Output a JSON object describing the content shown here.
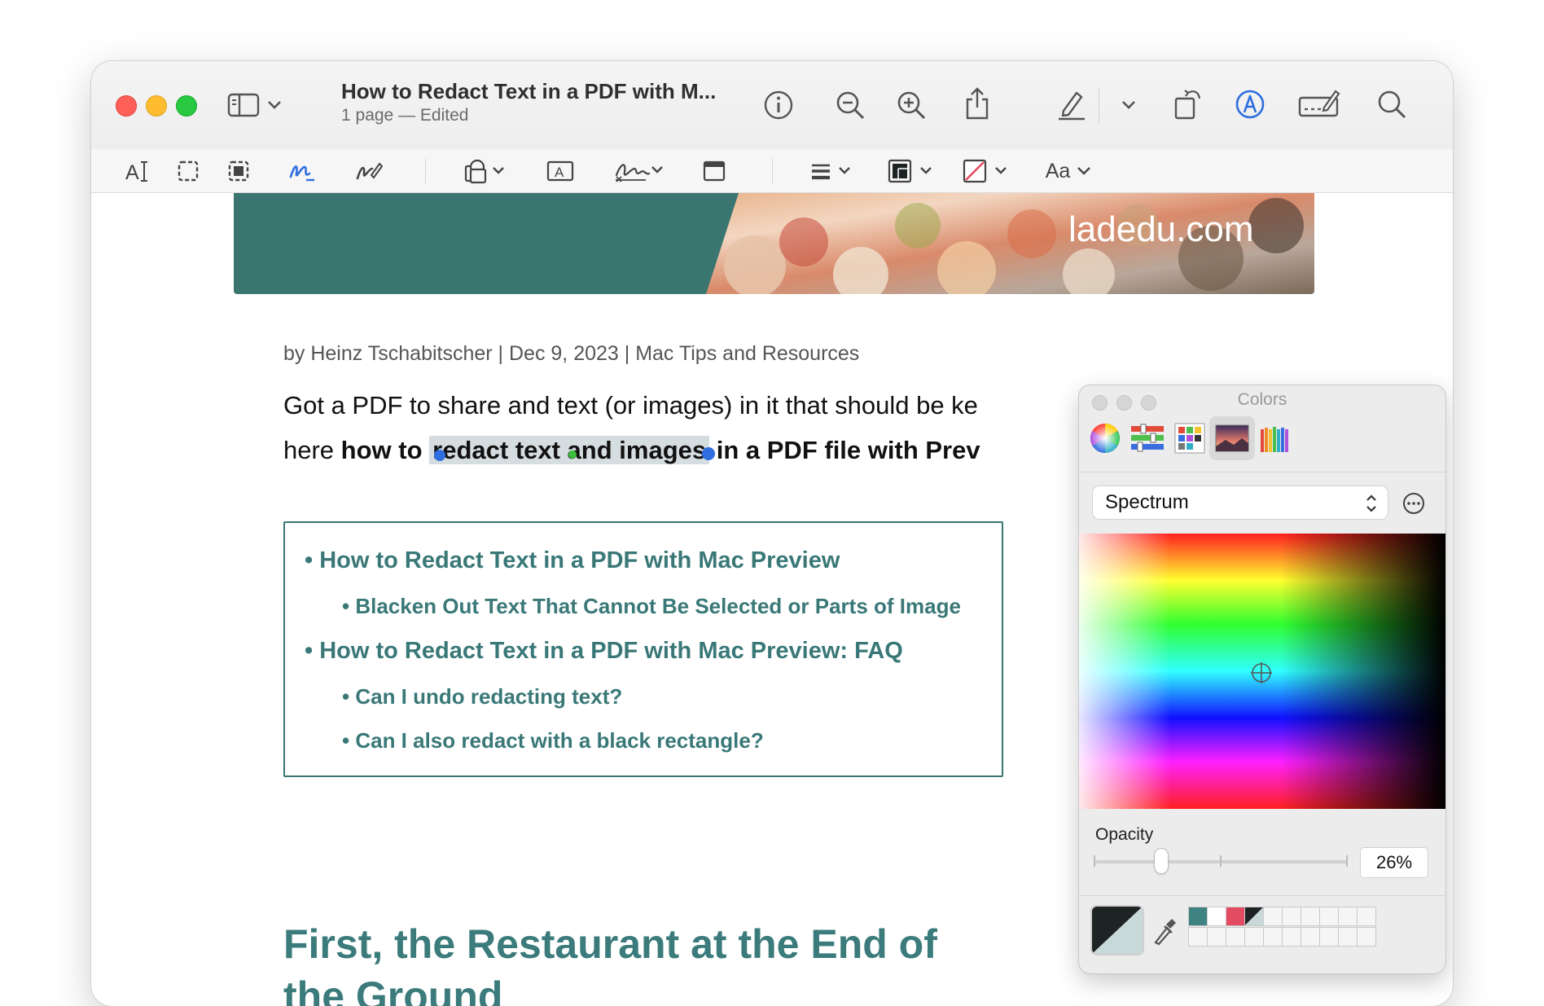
{
  "window": {
    "title": "How to Redact Text in a PDF with M...",
    "subtitle": "1 page — Edited"
  },
  "toolbar": {
    "icons": [
      "sidebar-icon",
      "chevron-down-icon",
      "info-icon",
      "zoom-out-icon",
      "zoom-in-icon",
      "share-icon",
      "highlight-pen-icon",
      "chevron-down-icon",
      "rotate-icon",
      "markup-icon",
      "form-filling-icon",
      "search-icon"
    ]
  },
  "markup_toolbar": {
    "text_style_label": "Aa",
    "icons": [
      "text-selection-icon",
      "rectangular-selection-icon",
      "redact-icon",
      "sketch-icon",
      "draw-icon",
      "shapes-icon",
      "text-box-icon",
      "sign-icon",
      "note-icon",
      "shape-style-icon",
      "border-color-icon",
      "fill-color-icon",
      "text-style-icon"
    ]
  },
  "document": {
    "banner_text": "ladedu.com",
    "byline": "by Heinz Tschabitscher | Dec 9, 2023 | Mac Tips and Resources",
    "intro_line1": "Got a PDF to share and text (or images) in it that should be ke",
    "intro_line2_prefix": "here ",
    "intro_line2_bold": "how to ",
    "intro_line2_selected": "redact text and images",
    "intro_line2_suffix": " in a PDF file with Prev",
    "toc": [
      {
        "text": "How to Redact Text in a PDF with Mac Preview",
        "level": 1
      },
      {
        "text": "Blacken Out Text That Cannot Be Selected or Parts of Image",
        "level": 2
      },
      {
        "text": "How to Redact Text in a PDF with Mac Preview: FAQ",
        "level": 1
      },
      {
        "text": "Can I undo redacting text?",
        "level": 2
      },
      {
        "text": "Can I also redact with a black rectangle?",
        "level": 2
      }
    ],
    "heading_line1": "First, the Restaurant at the End of",
    "heading_line2": "the Ground",
    "colors": {
      "accent": "#3b7b7b",
      "banner_teal": "#3a7570",
      "selection": "#d6dde0"
    }
  },
  "colors_panel": {
    "title": "Colors",
    "modes": [
      "color-wheel-icon",
      "color-sliders-icon",
      "color-palettes-icon",
      "image-palettes-icon",
      "pencils-icon"
    ],
    "palette_selector": "Spectrum",
    "opacity_label": "Opacity",
    "opacity_value": "26%",
    "opacity": 0.26,
    "current_color": "#1e2424",
    "swatches": [
      "#3f8282",
      "#ffffff",
      "#e24b62",
      "#1e2424"
    ]
  }
}
